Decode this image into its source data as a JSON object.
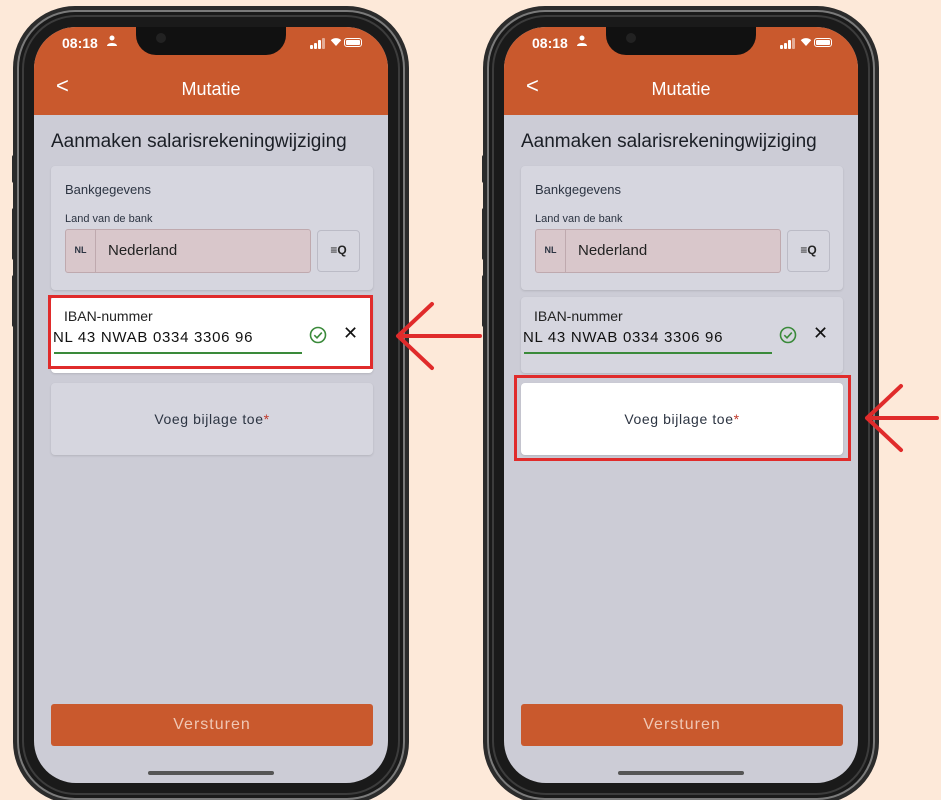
{
  "colors": {
    "accent": "#c9592d",
    "background": "#fde9d9",
    "highlight": "#e02b2b",
    "success": "#3a8a3a"
  },
  "screens": [
    {
      "status": {
        "time": "08:18",
        "person_icon": "person-icon",
        "signal_icon": "signal-bars-icon",
        "wifi_icon": "wifi-icon",
        "battery_icon": "battery-icon"
      },
      "appbar": {
        "back_icon": "chevron-left-icon",
        "back_glyph": "<",
        "title": "Mutatie"
      },
      "page_title": "Aanmaken salarisrekeningwijziging",
      "bank": {
        "heading": "Bankgegevens",
        "country_label": "Land van de bank",
        "country_code": "NL",
        "country_name": "Nederland",
        "search_icon": "list-search-icon",
        "search_glyph": "≡Q"
      },
      "iban": {
        "label": "IBAN-nummer",
        "value": "NL 43 NWAB 0334 3306 96",
        "check_icon": "check-circle-icon",
        "clear_icon": "close-icon",
        "clear_glyph": "✕"
      },
      "attachment": {
        "label": "Voeg bijlage toe",
        "required_mark": "*"
      },
      "submit": {
        "label": "Versturen"
      },
      "highlight_target": "iban"
    },
    {
      "status": {
        "time": "08:18",
        "person_icon": "person-icon",
        "signal_icon": "signal-bars-icon",
        "wifi_icon": "wifi-icon",
        "battery_icon": "battery-icon"
      },
      "appbar": {
        "back_icon": "chevron-left-icon",
        "back_glyph": "<",
        "title": "Mutatie"
      },
      "page_title": "Aanmaken salarisrekeningwijziging",
      "bank": {
        "heading": "Bankgegevens",
        "country_label": "Land van de bank",
        "country_code": "NL",
        "country_name": "Nederland",
        "search_icon": "list-search-icon",
        "search_glyph": "≡Q"
      },
      "iban": {
        "label": "IBAN-nummer",
        "value": "NL 43 NWAB 0334 3306 96",
        "check_icon": "check-circle-icon",
        "clear_icon": "close-icon",
        "clear_glyph": "✕"
      },
      "attachment": {
        "label": "Voeg bijlage toe",
        "required_mark": "*"
      },
      "submit": {
        "label": "Versturen"
      },
      "highlight_target": "attachment"
    }
  ],
  "annotations": {
    "arrow_icon": "red-arrow-left-icon"
  }
}
